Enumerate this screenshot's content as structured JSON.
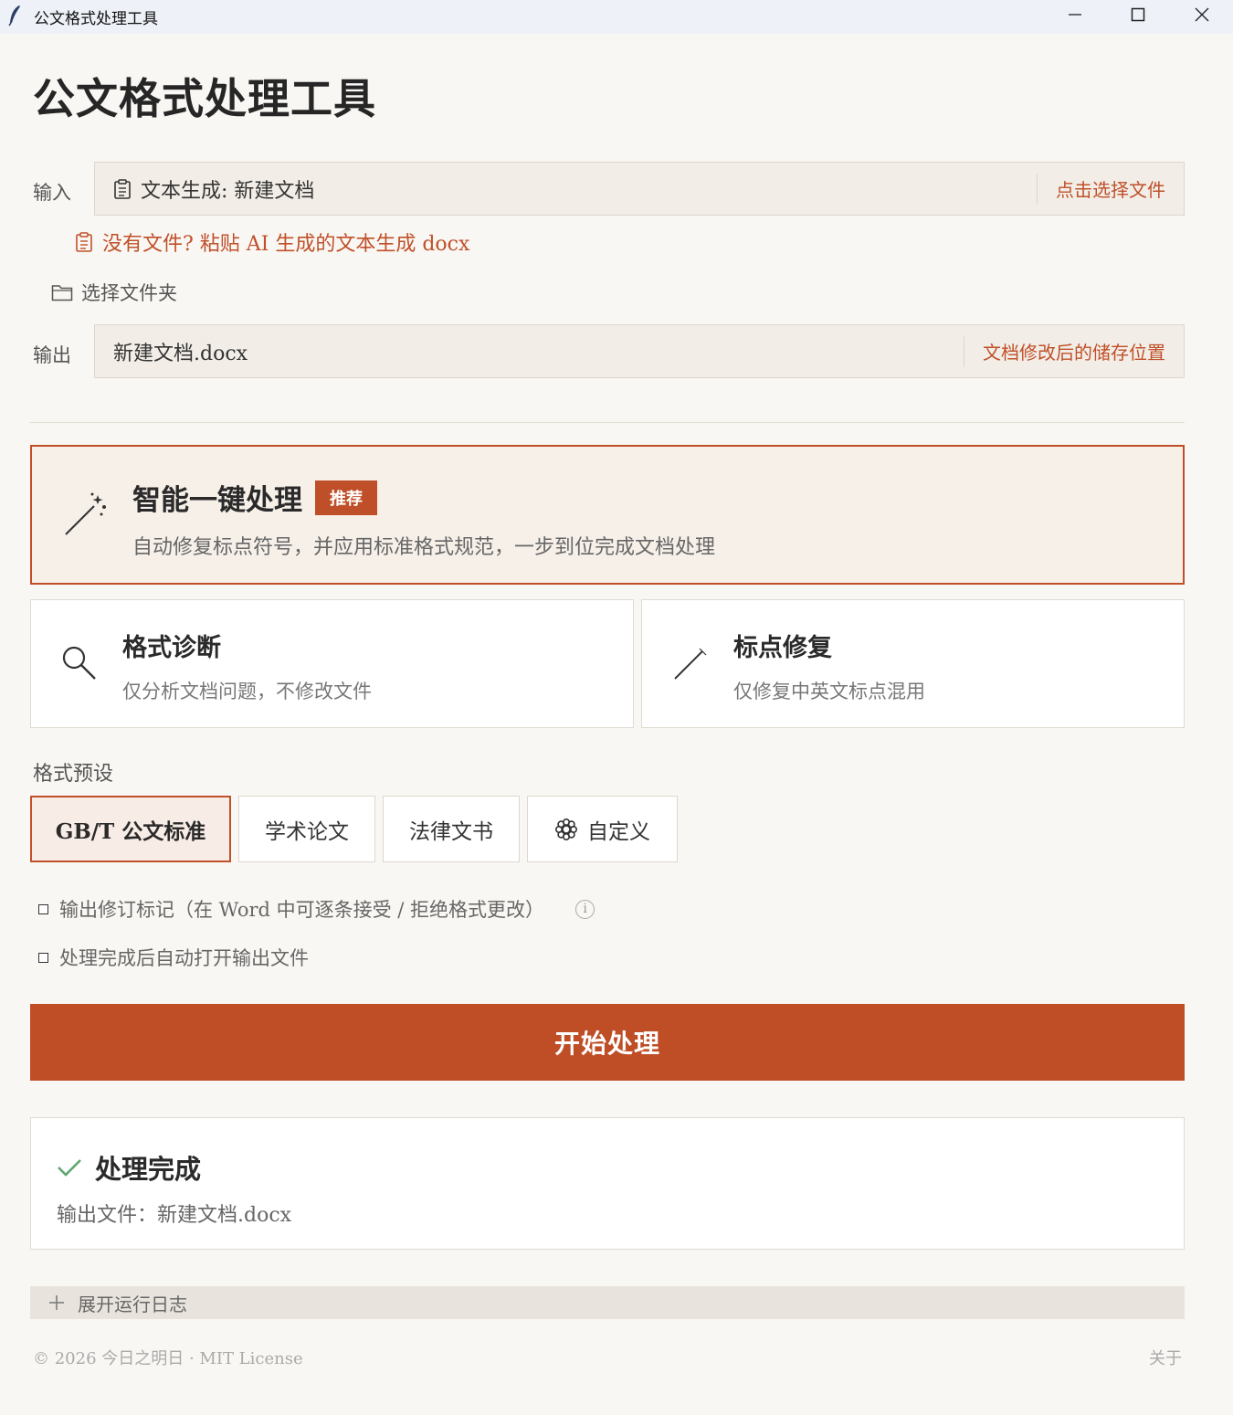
{
  "window": {
    "title": "公文格式处理工具",
    "min_icon": "minimize-icon",
    "max_icon": "maximize-icon",
    "close_icon": "close-icon"
  },
  "page_title": "公文格式处理工具",
  "input": {
    "label": "输入",
    "value": "文本生成: 新建文档",
    "action": "点击选择文件"
  },
  "paste_link": "没有文件? 粘贴 AI 生成的文本生成 docx",
  "folder_link": "选择文件夹",
  "output": {
    "label": "输出",
    "value": "新建文档.docx",
    "action": "文档修改后的储存位置"
  },
  "smart": {
    "title": "智能一键处理",
    "badge": "推荐",
    "description": "自动修复标点符号，并应用标准格式规范，一步到位完成文档处理"
  },
  "modes": [
    {
      "title": "格式诊断",
      "description": "仅分析文档问题，不修改文件",
      "icon": "search-icon"
    },
    {
      "title": "标点修复",
      "description": "仅修复中英文标点混用",
      "icon": "pen-icon"
    }
  ],
  "preset": {
    "label": "格式预设",
    "options": [
      "GB/T 公文标准",
      "学术论文",
      "法律文书",
      "自定义"
    ],
    "selected": "GB/T 公文标准"
  },
  "options": {
    "track_changes": {
      "label": "输出修订标记（在 Word 中可逐条接受 / 拒绝格式更改）",
      "checked": false,
      "info": "i"
    },
    "auto_open": {
      "label": "处理完成后自动打开输出文件",
      "checked": false
    }
  },
  "start_button": "开始处理",
  "result": {
    "title": "处理完成",
    "output_file": "输出文件：新建文档.docx"
  },
  "log_toggle": "展开运行日志",
  "footer": {
    "copyright": "© 2026 今日之明日 · MIT License",
    "about": "关于"
  },
  "colors": {
    "accent": "#bf4e27",
    "background": "#f9f7f3",
    "success": "#5fa66f"
  }
}
